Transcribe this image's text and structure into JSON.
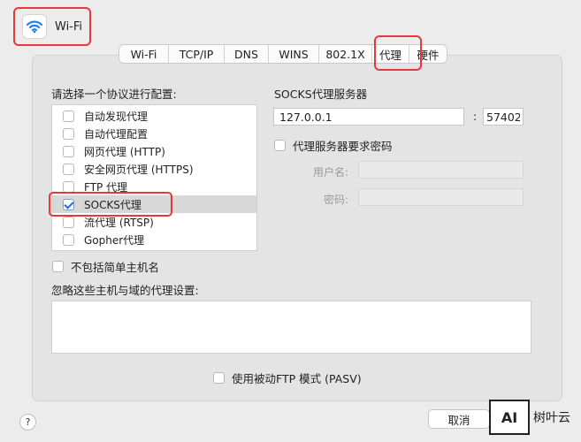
{
  "header": {
    "title": "Wi-Fi",
    "icon": "wifi-icon"
  },
  "tabs": [
    {
      "label": "Wi-Fi"
    },
    {
      "label": "TCP/IP"
    },
    {
      "label": "DNS"
    },
    {
      "label": "WINS"
    },
    {
      "label": "802.1X"
    },
    {
      "label": "代理"
    },
    {
      "label": "硬件"
    }
  ],
  "active_tab": "代理",
  "proxy": {
    "protocol_prompt": "请选择一个协议进行配置:",
    "protocols": [
      {
        "label": "自动发现代理",
        "checked": false
      },
      {
        "label": "自动代理配置",
        "checked": false
      },
      {
        "label": "网页代理 (HTTP)",
        "checked": false
      },
      {
        "label": "安全网页代理 (HTTPS)",
        "checked": false
      },
      {
        "label": "FTP 代理",
        "checked": false
      },
      {
        "label": "SOCKS代理",
        "checked": true
      },
      {
        "label": "流代理 (RTSP)",
        "checked": false
      },
      {
        "label": "Gopher代理",
        "checked": false
      }
    ],
    "server_heading": "SOCKS代理服务器",
    "server_host": "127.0.0.1",
    "port_separator": ":",
    "server_port": "57402",
    "auth_label": "代理服务器要求密码",
    "auth_checked": false,
    "username_label": "用户名:",
    "password_label": "密码:",
    "exclude_simple_label": "不包括简单主机名",
    "exclude_simple_checked": false,
    "bypass_label": "忽略这些主机与域的代理设置:",
    "bypass_value": "",
    "pasv_label": "使用被动FTP 模式 (PASV)",
    "pasv_checked": false
  },
  "footer": {
    "help_label": "?",
    "cancel_label": "取消"
  },
  "watermark": {
    "logo_text": "AI",
    "brand": "树叶云"
  },
  "colors": {
    "highlight": "#e8383d",
    "accent": "#1a6fe0",
    "wifi": "#1a7ff0"
  }
}
